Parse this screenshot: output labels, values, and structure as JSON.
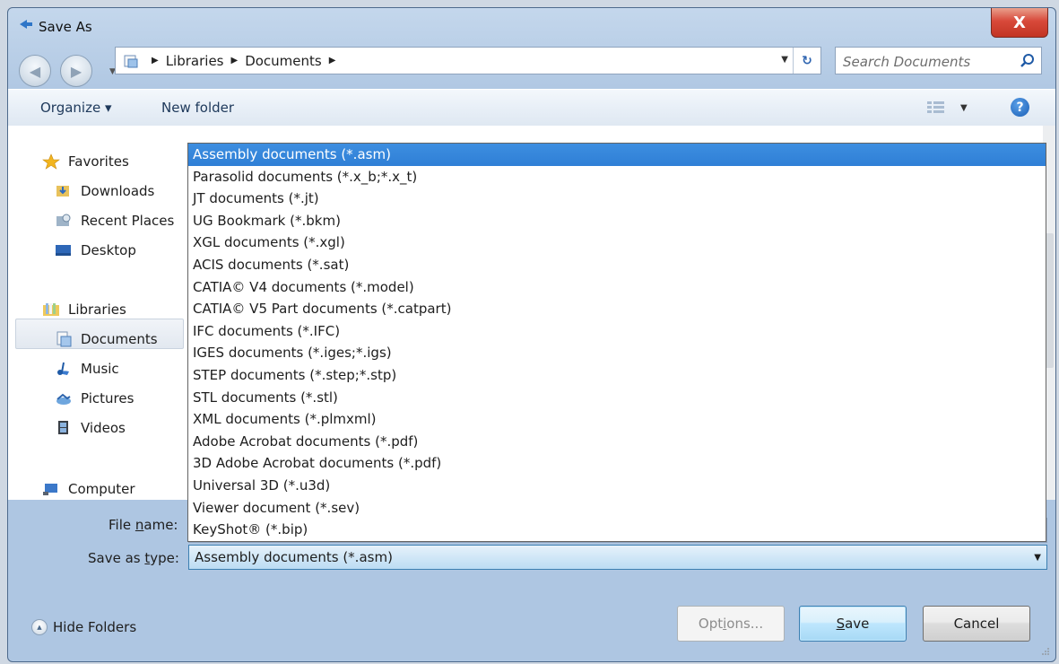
{
  "window": {
    "title": "Save As",
    "close_label": "X"
  },
  "address": {
    "crumbs": [
      "Libraries",
      "Documents"
    ]
  },
  "search": {
    "placeholder": "Search Documents"
  },
  "toolbar": {
    "organize": "Organize ▾",
    "new_folder": "New folder"
  },
  "nav": {
    "favorites": "Favorites",
    "downloads": "Downloads",
    "recent_places": "Recent Places",
    "desktop": "Desktop",
    "libraries": "Libraries",
    "documents": "Documents",
    "music": "Music",
    "pictures": "Pictures",
    "videos": "Videos",
    "computer": "Computer"
  },
  "type_options": [
    "Assembly documents (*.asm)",
    "Parasolid documents (*.x_b;*.x_t)",
    "JT documents (*.jt)",
    "UG Bookmark (*.bkm)",
    "XGL documents (*.xgl)",
    "ACIS documents (*.sat)",
    "CATIA© V4 documents (*.model)",
    "CATIA© V5 Part documents (*.catpart)",
    "IFC documents (*.IFC)",
    "IGES documents (*.iges;*.igs)",
    "STEP documents (*.step;*.stp)",
    "STL documents (*.stl)",
    "XML documents (*.plmxml)",
    "Adobe Acrobat documents (*.pdf)",
    "3D Adobe Acrobat documents (*.pdf)",
    "Universal 3D (*.u3d)",
    "Viewer document (*.sev)",
    "KeyShot® (*.bip)"
  ],
  "form": {
    "file_name_label_pre": "File ",
    "file_name_label_u": "n",
    "file_name_label_post": "ame:",
    "save_type_label_pre": "Save as ",
    "save_type_label_u": "t",
    "save_type_label_post": "ype:",
    "save_type_value": "Assembly documents (*.asm)"
  },
  "footer": {
    "hide_folders": "Hide Folders",
    "options_pre": "Opt",
    "options_u": "i",
    "options_post": "ons...",
    "save_u": "S",
    "save_post": "ave",
    "cancel": "Cancel"
  },
  "colors": {
    "selection": "#3399ff",
    "close": "#c23423"
  }
}
